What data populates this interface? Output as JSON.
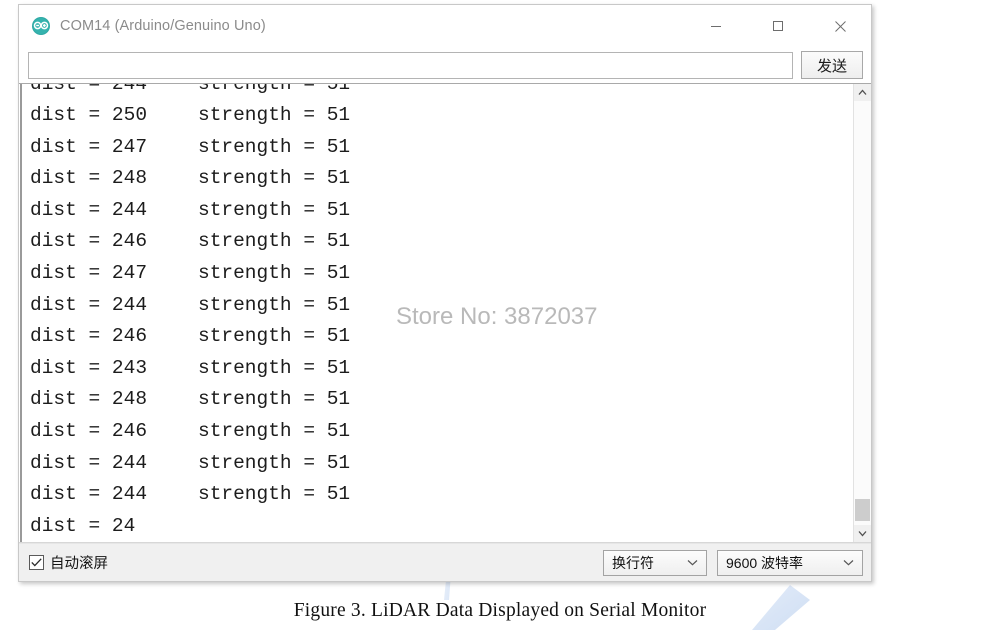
{
  "window": {
    "title": "COM14 (Arduino/Genuino Uno)",
    "logo_icon": "arduino-logo-icon",
    "controls": {
      "minimize": "minimize-icon",
      "maximize": "maximize-icon",
      "close": "close-icon"
    }
  },
  "command_bar": {
    "input_value": "",
    "input_placeholder": "",
    "send_label": "发送"
  },
  "console": {
    "lines": [
      {
        "dist": "dist = 244",
        "strength": "strength = 51",
        "clipped": true
      },
      {
        "dist": "dist = 250",
        "strength": "strength = 51",
        "clipped": false
      },
      {
        "dist": "dist = 247",
        "strength": "strength = 51",
        "clipped": false
      },
      {
        "dist": "dist = 248",
        "strength": "strength = 51",
        "clipped": false
      },
      {
        "dist": "dist = 244",
        "strength": "strength = 51",
        "clipped": false
      },
      {
        "dist": "dist = 246",
        "strength": "strength = 51",
        "clipped": false
      },
      {
        "dist": "dist = 247",
        "strength": "strength = 51",
        "clipped": false
      },
      {
        "dist": "dist = 244",
        "strength": "strength = 51",
        "clipped": false
      },
      {
        "dist": "dist = 246",
        "strength": "strength = 51",
        "clipped": false
      },
      {
        "dist": "dist = 243",
        "strength": "strength = 51",
        "clipped": false
      },
      {
        "dist": "dist = 248",
        "strength": "strength = 51",
        "clipped": false
      },
      {
        "dist": "dist = 246",
        "strength": "strength = 51",
        "clipped": false
      },
      {
        "dist": "dist = 244",
        "strength": "strength = 51",
        "clipped": false
      },
      {
        "dist": "dist = 244",
        "strength": "strength = 51",
        "clipped": false
      },
      {
        "dist": "dist = 24",
        "strength": "",
        "clipped": false
      }
    ],
    "scrollbar": {
      "up_icon": "chevron-up-icon",
      "down_icon": "chevron-down-icon"
    }
  },
  "status_bar": {
    "autoscroll_label": "自动滚屏",
    "autoscroll_checked": true,
    "newline_value": "换行符",
    "baud_value": "9600 波特率",
    "dropdown_icon": "chevron-down-icon"
  },
  "caption": "Figure 3. LiDAR Data Displayed on Serial Monitor",
  "watermark": {
    "store_text": "Store No: 3872037",
    "shape_color": "#ccd9f2"
  }
}
